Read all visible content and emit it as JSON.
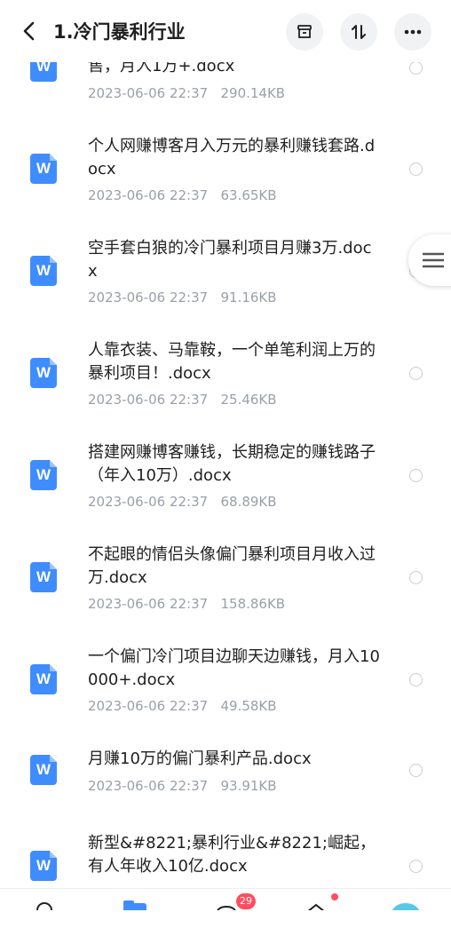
{
  "header": {
    "title": "1.冷门暴利行业",
    "back_icon": "chevron-left-icon",
    "actions": [
      "archive-icon",
      "sort-icon",
      "more-icon"
    ]
  },
  "files": [
    {
      "name": "售，月入1万+.docx",
      "date": "2023-06-06  22:37",
      "size": "290.14KB"
    },
    {
      "name": "个人网赚博客月入万元的暴利赚钱套路.docx",
      "date": "2023-06-06  22:37",
      "size": "63.65KB"
    },
    {
      "name": "空手套白狼的冷门暴利项目月赚3万.docx",
      "date": "2023-06-06  22:37",
      "size": "91.16KB"
    },
    {
      "name": "人靠衣装、马靠鞍，一个单笔利润上万的暴利项目！.docx",
      "date": "2023-06-06  22:37",
      "size": "25.46KB"
    },
    {
      "name": "搭建网赚博客赚钱，长期稳定的赚钱路子（年入10万）.docx",
      "date": "2023-06-06  22:37",
      "size": "68.89KB"
    },
    {
      "name": "不起眼的情侣头像偏门暴利项目月收入过万.docx",
      "date": "2023-06-06  22:37",
      "size": "158.86KB"
    },
    {
      "name": "一个偏门冷门项目边聊天边赚钱，月入10000+.docx",
      "date": "2023-06-06  22:37",
      "size": "49.58KB"
    },
    {
      "name": "月赚10万的偏门暴利产品.docx",
      "date": "2023-06-06  22:37",
      "size": "93.91KB"
    },
    {
      "name": "新型&#8221;暴利行业&#8221;崛起，有人年收入10亿.docx",
      "date": "",
      "size": ""
    }
  ],
  "bottom_nav": {
    "badge_count": "29"
  },
  "colors": {
    "accent": "#3f8cff",
    "meta_text": "#9aa0a8",
    "badge": "#ff4d5e"
  }
}
